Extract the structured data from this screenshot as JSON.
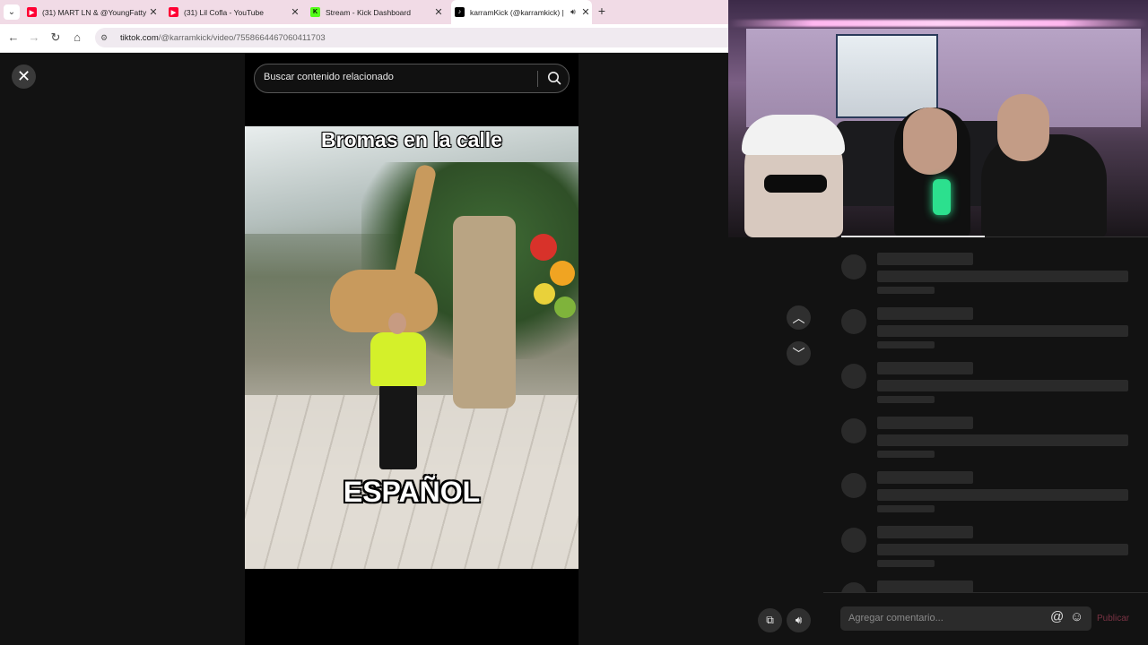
{
  "browser": {
    "tab_menu_icon": "chevron-down-icon",
    "tabs": [
      {
        "title": "(31) MART LN & @YoungFatty",
        "favicon": "youtube-icon",
        "favicon_color": "#ff0033"
      },
      {
        "title": "(31) Lil Cofla - YouTube",
        "favicon": "youtube-icon",
        "favicon_color": "#ff0033"
      },
      {
        "title": "Stream - Kick Dashboard",
        "favicon": "kick-icon",
        "favicon_color": "#53fc18"
      },
      {
        "title": "karramKick (@karramkick) |",
        "favicon": "tiktok-icon",
        "favicon_color": "#000000",
        "active": true
      }
    ],
    "close_glyph": "✕",
    "new_tab_glyph": "+",
    "url_host": "tiktok.com",
    "url_path": "/@karramkick/video/7558664467060411703"
  },
  "tiktok": {
    "search_placeholder": "Buscar contenido relacionado",
    "caption_top": "Bromas en la calle",
    "caption_bottom": "ESPAÑOL",
    "close_glyph": "✕",
    "comment_placeholder": "Agregar comentario...",
    "at_glyph": "@",
    "emoji_glyph": "☺",
    "publish_label": "Publicar",
    "nav_up_glyph": "︿",
    "nav_down_glyph": "﹀",
    "skeleton_rows": 7
  },
  "colors": {
    "accent_publish": "#7a3344",
    "tabbar_bg": "#f1dbe6",
    "page_bg": "#121212"
  }
}
